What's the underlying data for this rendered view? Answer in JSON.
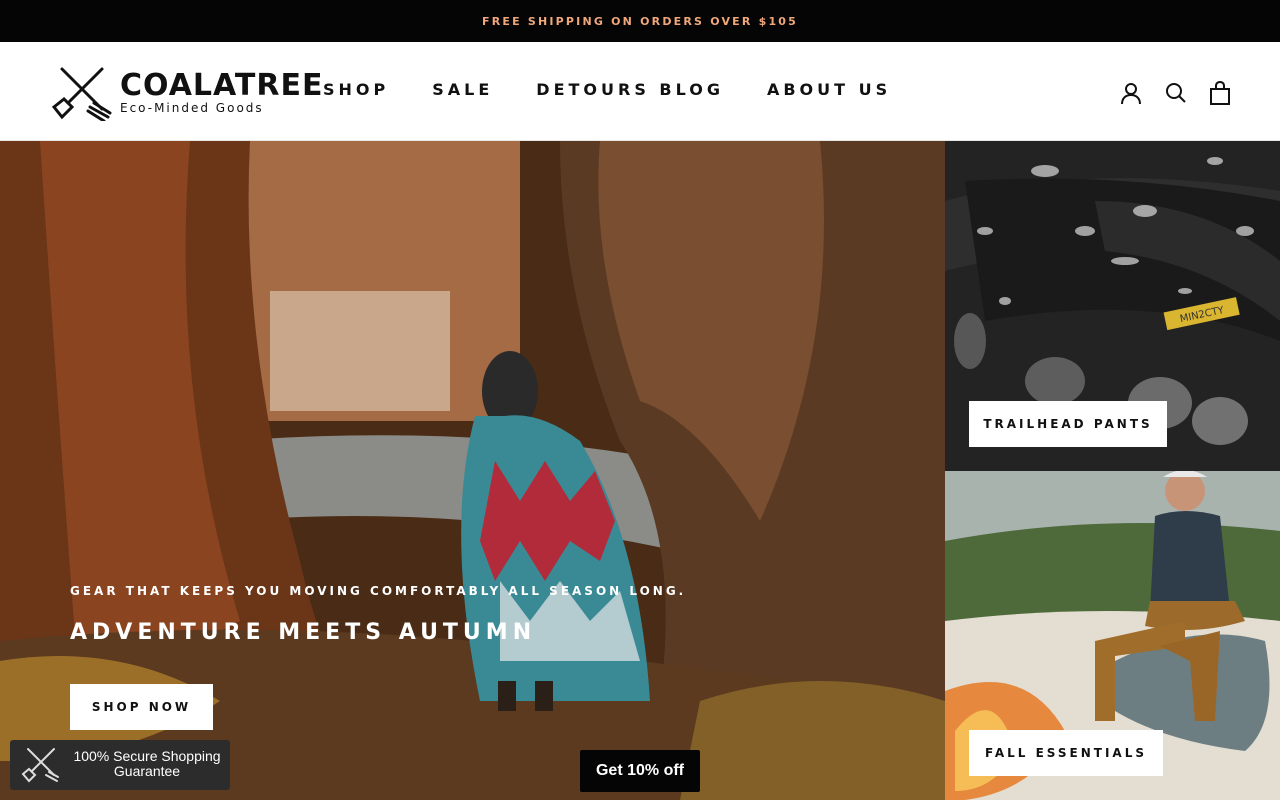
{
  "announcement": {
    "text": "FREE SHIPPING ON ORDERS OVER $105"
  },
  "brand": {
    "name": "COALATREE",
    "tagline": "Eco-Minded Goods"
  },
  "nav": [
    {
      "label": "SHOP"
    },
    {
      "label": "SALE"
    },
    {
      "label": "DETOURS BLOG"
    },
    {
      "label": "ABOUT US"
    }
  ],
  "header_icons": [
    "account-icon",
    "search-icon",
    "cart-icon"
  ],
  "hero": {
    "subtitle": "GEAR THAT KEEPS YOU MOVING COMFORTABLY ALL SEASON LONG.",
    "title": "ADVENTURE MEETS AUTUMN",
    "button": "SHOP NOW"
  },
  "panels": [
    {
      "button": "TRAILHEAD PANTS",
      "label_text": "MIN2CTY"
    },
    {
      "button": "FALL ESSENTIALS"
    }
  ],
  "secure_badge": {
    "text": "100% Secure Shopping Guarantee"
  },
  "discount_button": {
    "label": "Get 10% off"
  },
  "colors": {
    "announcement_bg": "#050505",
    "announcement_text": "#f0a77a",
    "button_bg": "#ffffff",
    "text_dark": "#111111"
  }
}
